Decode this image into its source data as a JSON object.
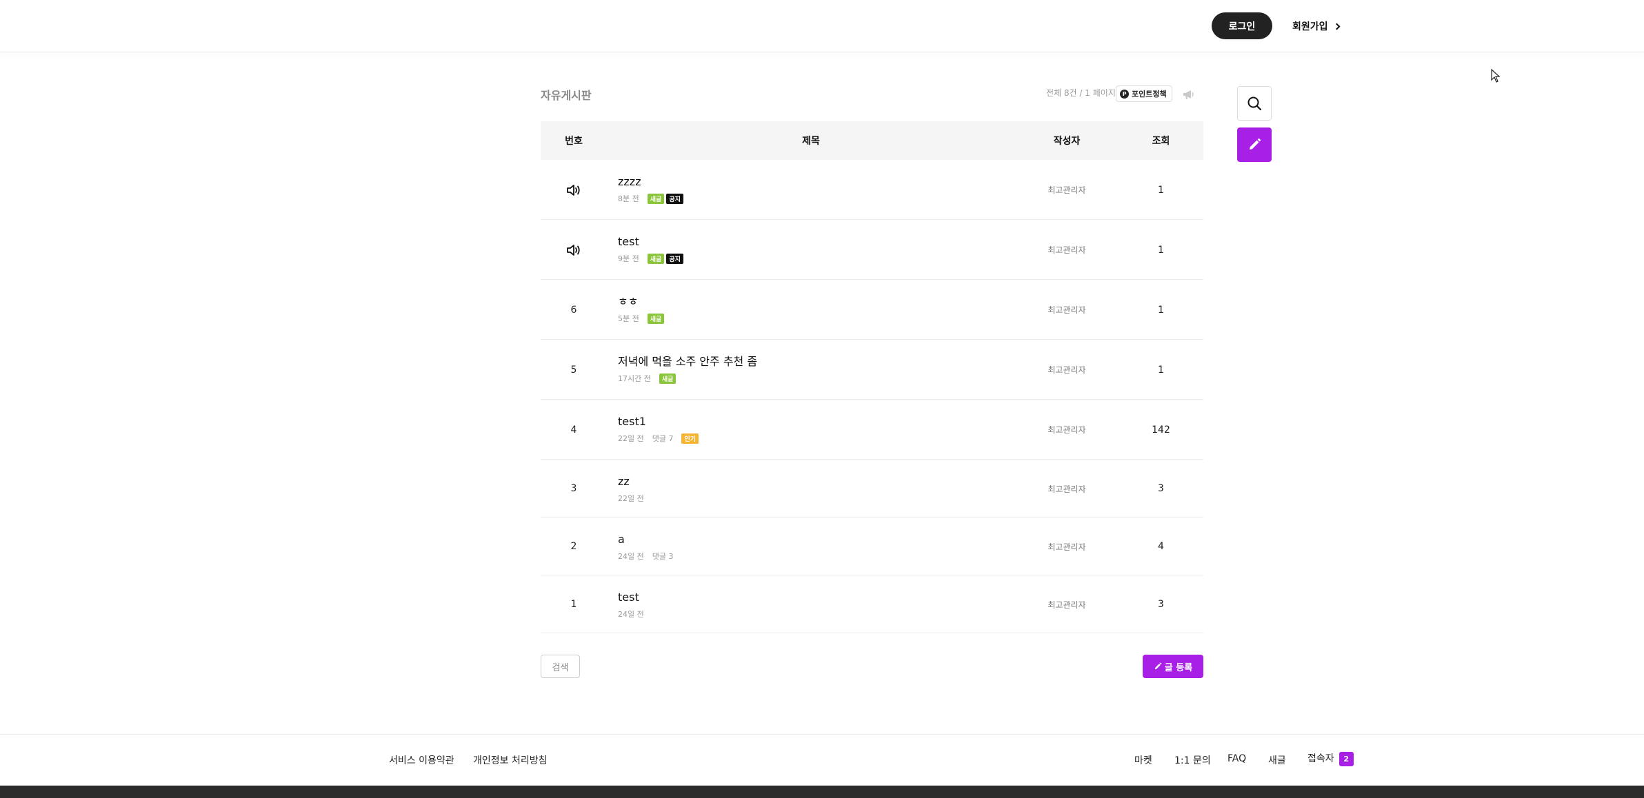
{
  "header": {
    "login_label": "로그인",
    "signup_label": "회원가입"
  },
  "board": {
    "title": "자유게시판",
    "meta": "전체 8건 / 1 페이지",
    "point_policy_label": "포인트정책",
    "point_icon_letter": "P",
    "columns": {
      "no": "번호",
      "title": "제목",
      "author": "작성자",
      "views": "조회"
    },
    "rows": [
      {
        "no": "",
        "notice": true,
        "title": "zzzz",
        "time": "8분 전",
        "comments": "",
        "badges": [
          "새글",
          "공지"
        ],
        "author": "최고관리자",
        "views": "1"
      },
      {
        "no": "",
        "notice": true,
        "title": "test",
        "time": "9분 전",
        "comments": "",
        "badges": [
          "새글",
          "공지"
        ],
        "author": "최고관리자",
        "views": "1"
      },
      {
        "no": "6",
        "notice": false,
        "title": "ㅎㅎ",
        "time": "5분 전",
        "comments": "",
        "badges": [
          "새글"
        ],
        "author": "최고관리자",
        "views": "1"
      },
      {
        "no": "5",
        "notice": false,
        "title": "저녁에 먹을 소주 안주 추천 좀",
        "time": "17시간 전",
        "comments": "",
        "badges": [
          "새글"
        ],
        "author": "최고관리자",
        "views": "1"
      },
      {
        "no": "4",
        "notice": false,
        "title": "test1",
        "time": "22일 전",
        "comments": "댓글 7",
        "badges": [
          "인기"
        ],
        "author": "최고관리자",
        "views": "142"
      },
      {
        "no": "3",
        "notice": false,
        "title": "zz",
        "time": "22일 전",
        "comments": "",
        "badges": [],
        "author": "최고관리자",
        "views": "3"
      },
      {
        "no": "2",
        "notice": false,
        "title": "a",
        "time": "24일 전",
        "comments": "댓글 3",
        "badges": [],
        "author": "최고관리자",
        "views": "4"
      },
      {
        "no": "1",
        "notice": false,
        "title": "test",
        "time": "24일 전",
        "comments": "",
        "badges": [],
        "author": "최고관리자",
        "views": "3"
      }
    ],
    "search_label": "검색",
    "write_label": "글 등록"
  },
  "footer": {
    "terms": "서비스 이용약관",
    "privacy": "개인정보 처리방침",
    "market": "마켓",
    "inquiry": "1:1 문의",
    "faq": "FAQ",
    "new_posts": "새글",
    "visitors_label": "접속자",
    "visitors_count": "2"
  },
  "colors": {
    "accent": "#a81fe6",
    "badge_new": "#8bc53a",
    "badge_notice": "#111111",
    "badge_hot": "#f5b431"
  },
  "icons": {
    "notice": "speaker-icon",
    "search": "search-icon",
    "write": "pencil-icon",
    "megaphone": "megaphone-icon"
  }
}
